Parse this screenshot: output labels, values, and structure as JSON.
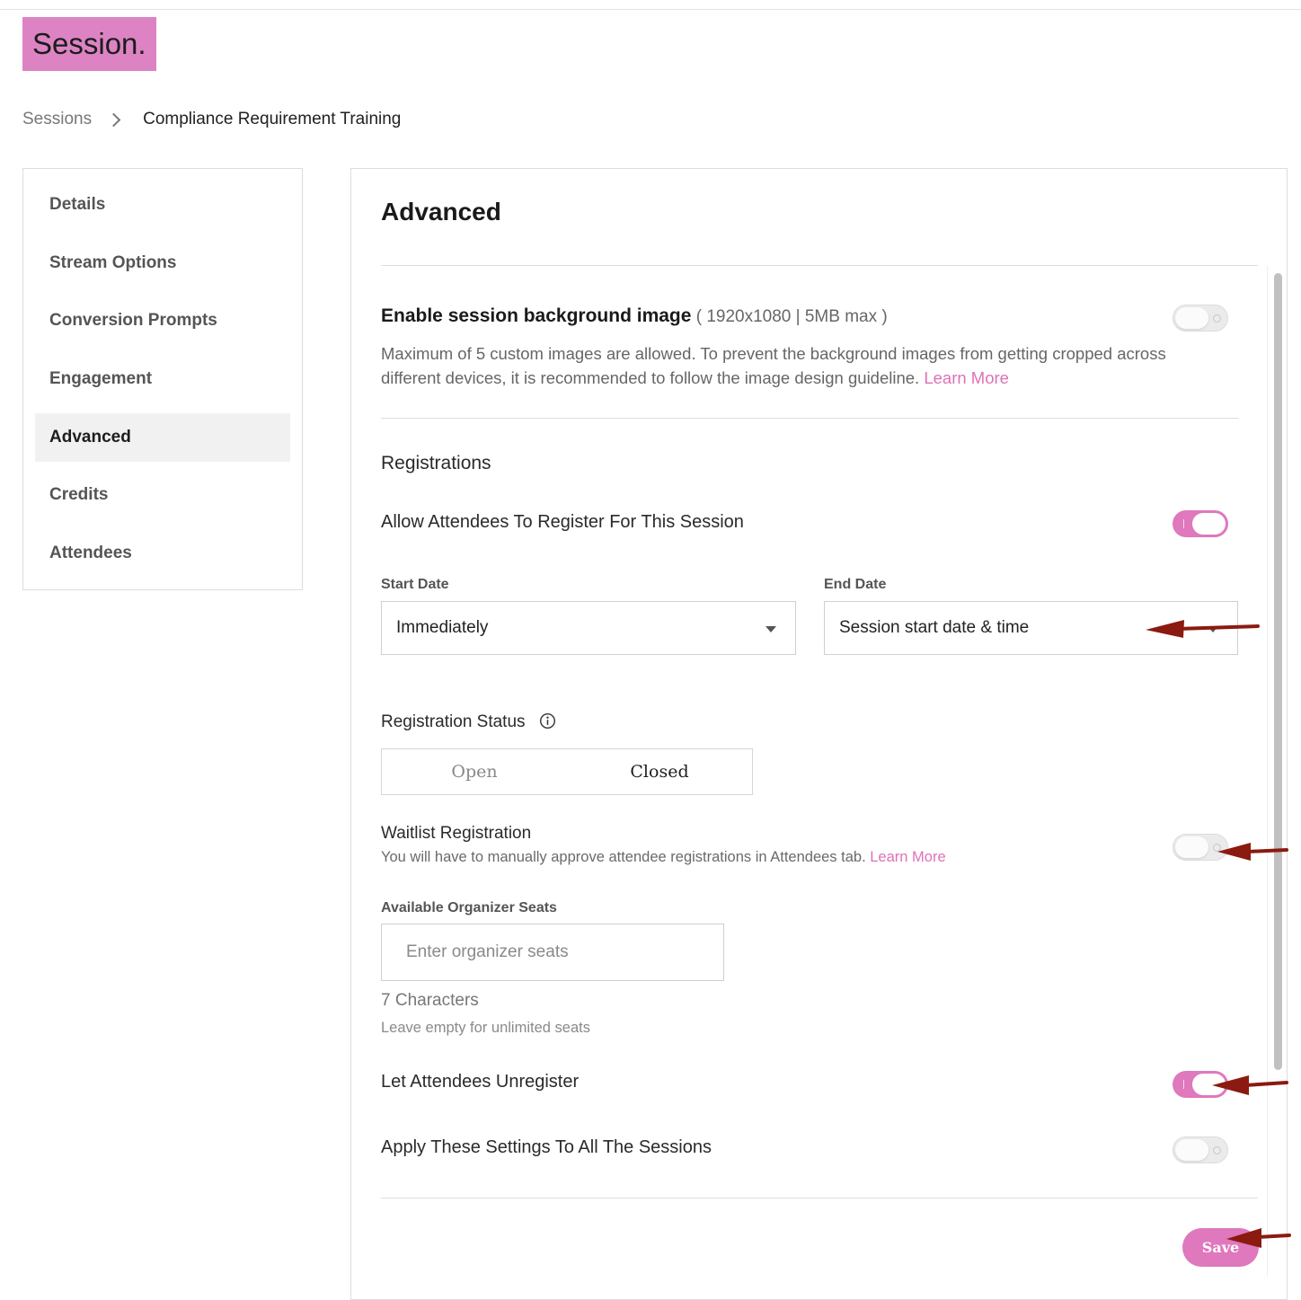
{
  "brand": {
    "logo_text": "Session.",
    "logo_bg": "#dd83c3"
  },
  "breadcrumb": {
    "parent": "Sessions",
    "current": "Compliance Requirement Training",
    "separator_icon": "chevron-right-icon"
  },
  "sidebar": {
    "items": [
      {
        "label": "Details",
        "active": false
      },
      {
        "label": "Stream Options",
        "active": false
      },
      {
        "label": "Conversion Prompts",
        "active": false
      },
      {
        "label": "Engagement",
        "active": false
      },
      {
        "label": "Advanced",
        "active": true
      },
      {
        "label": "Credits",
        "active": false
      },
      {
        "label": "Attendees",
        "active": false
      }
    ]
  },
  "main": {
    "title": "Advanced",
    "background_image": {
      "label": "Enable session background image",
      "spec": " ( 1920x1080 | 5MB max )",
      "description": "Maximum of 5 custom images are allowed. To prevent the background images from getting cropped across different devices, it is recommended to follow the image design guideline. ",
      "learn_more": "Learn More",
      "enabled": false
    },
    "registrations": {
      "section_title": "Registrations",
      "allow_register": {
        "label": "Allow Attendees To Register For This Session",
        "enabled": true
      },
      "start_date": {
        "label": "Start Date",
        "value": "Immediately"
      },
      "end_date": {
        "label": "End Date",
        "value": "Session start date & time"
      },
      "status": {
        "label": "Registration Status",
        "info_icon": "info-icon",
        "options": [
          "Open",
          "Closed"
        ],
        "selected": "Closed"
      },
      "waitlist": {
        "label": "Waitlist Registration",
        "description": "You will have to manually approve attendee registrations in Attendees tab. ",
        "learn_more": "Learn More",
        "enabled": false
      },
      "organizer_seats": {
        "label": "Available Organizer Seats",
        "placeholder": "Enter organizer seats",
        "value": "",
        "char_count": "7 Characters",
        "hint": "Leave empty for unlimited seats"
      },
      "unregister": {
        "label": "Let Attendees Unregister",
        "enabled": true
      },
      "apply_all": {
        "label": "Apply These Settings To All The Sessions",
        "enabled": false
      }
    },
    "save_label": "Save"
  },
  "colors": {
    "accent": "#df78bd",
    "annotation_arrow": "#8b1a10"
  }
}
